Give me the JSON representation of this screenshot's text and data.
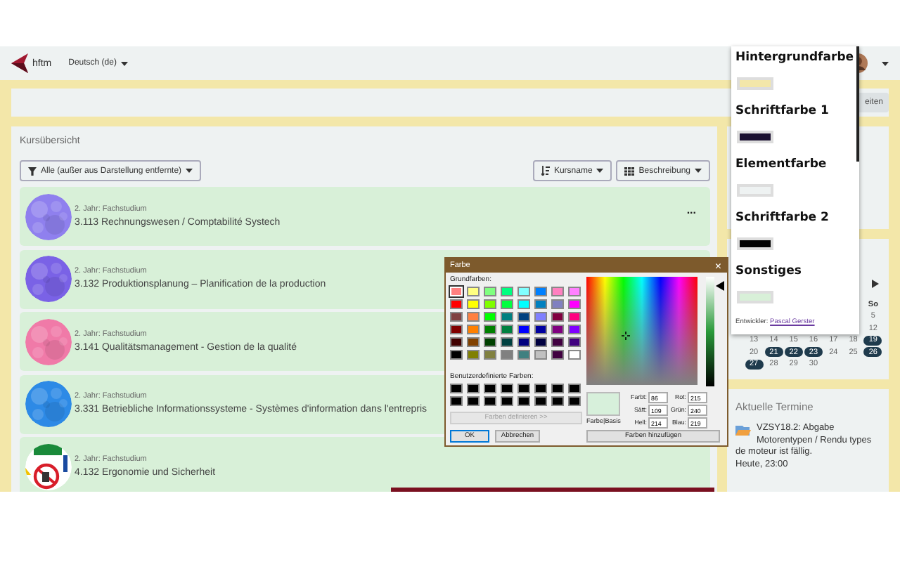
{
  "nav": {
    "logo_text": "hftm",
    "language": "Deutsch (de)"
  },
  "header": {
    "button": "eiten"
  },
  "courses_card": {
    "title": "Kursübersicht",
    "filter": "Alle (außer aus Darstellung entfernte)",
    "sort": "Kursname",
    "view": "Beschreibung",
    "courses": [
      {
        "category": "2. Jahr: Fachstudium",
        "name": "3.113 Rechnungswesen / Comptabilité Systech",
        "menu": "..."
      },
      {
        "category": "2. Jahr: Fachstudium",
        "name": "3.132 Produktionsplanung – Planification de la production"
      },
      {
        "category": "2. Jahr: Fachstudium",
        "name": "3.141 Qualitätsmanagement - Gestion de la qualité"
      },
      {
        "category": "2. Jahr: Fachstudium",
        "name": "3.331 Betriebliche Informationssysteme - Systèmes d'information dans l'entrepris"
      },
      {
        "category": "2. Jahr: Fachstudium",
        "name": "4.132 Ergonomie und Sicherheit"
      }
    ]
  },
  "calendar": {
    "sunday_label": "So",
    "sunday_days": [
      "5",
      "12"
    ],
    "weeks": [
      {
        "days": [
          {
            "day": "13",
            "highlighted": false
          },
          {
            "day": "14",
            "highlighted": false
          },
          {
            "day": "15",
            "highlighted": false
          },
          {
            "day": "16",
            "highlighted": false
          },
          {
            "day": "17",
            "highlighted": false
          },
          {
            "day": "18",
            "highlighted": false
          },
          {
            "day": "19",
            "highlighted": true
          }
        ]
      },
      {
        "days": [
          {
            "day": "20",
            "highlighted": false
          },
          {
            "day": "21",
            "highlighted": true
          },
          {
            "day": "22",
            "highlighted": true
          },
          {
            "day": "23",
            "highlighted": true
          },
          {
            "day": "24",
            "highlighted": false
          },
          {
            "day": "25",
            "highlighted": false
          },
          {
            "day": "26",
            "highlighted": true
          }
        ]
      },
      {
        "days": [
          {
            "day": "27",
            "highlighted": true
          },
          {
            "day": "28",
            "highlighted": false
          },
          {
            "day": "29",
            "highlighted": false
          },
          {
            "day": "30",
            "highlighted": false
          }
        ]
      }
    ]
  },
  "events": {
    "title": "Aktuelle Termine",
    "items": [
      {
        "text": "VZSY18.2: Abgabe Motorentypen / Rendu types de moteur ist fällig.",
        "time": "Heute, 23:00"
      }
    ]
  },
  "theme_popup": {
    "sections": [
      {
        "title": "Hintergrundfarbe",
        "color": "#f3e7a9"
      },
      {
        "title": "Schriftfarbe 1",
        "color": "#1a1030"
      },
      {
        "title": "Elementfarbe",
        "color": "#eef2f2"
      },
      {
        "title": "Schriftfarbe 2",
        "color": "#000000"
      },
      {
        "title": "Sonstiges",
        "color": "#d8f0d8"
      }
    ],
    "credit_label": "Entwickler:",
    "credit_link": "Pascal Gerster"
  },
  "color_dialog": {
    "title": "Farbe",
    "close": "×",
    "basic_label": "Grundfarben:",
    "basic_colors": [
      {
        "color": "#ff8080",
        "selected": true
      },
      {
        "color": "#ffff80",
        "selected": false
      },
      {
        "color": "#80ff80",
        "selected": false
      },
      {
        "color": "#00ff80",
        "selected": false
      },
      {
        "color": "#80ffff",
        "selected": false
      },
      {
        "color": "#0080ff",
        "selected": false
      },
      {
        "color": "#ff80c0",
        "selected": false
      },
      {
        "color": "#ff80ff",
        "selected": false
      },
      {
        "color": "#ff0000",
        "selected": false
      },
      {
        "color": "#ffff00",
        "selected": false
      },
      {
        "color": "#80ff00",
        "selected": false
      },
      {
        "color": "#00ff40",
        "selected": false
      },
      {
        "color": "#00ffff",
        "selected": false
      },
      {
        "color": "#0080c0",
        "selected": false
      },
      {
        "color": "#8080c0",
        "selected": false
      },
      {
        "color": "#ff00ff",
        "selected": false
      },
      {
        "color": "#804040",
        "selected": false
      },
      {
        "color": "#ff8040",
        "selected": false
      },
      {
        "color": "#00ff00",
        "selected": false
      },
      {
        "color": "#008080",
        "selected": false
      },
      {
        "color": "#004080",
        "selected": false
      },
      {
        "color": "#8080ff",
        "selected": false
      },
      {
        "color": "#800040",
        "selected": false
      },
      {
        "color": "#ff0080",
        "selected": false
      },
      {
        "color": "#800000",
        "selected": false
      },
      {
        "color": "#ff8000",
        "selected": false
      },
      {
        "color": "#008000",
        "selected": false
      },
      {
        "color": "#008040",
        "selected": false
      },
      {
        "color": "#0000ff",
        "selected": false
      },
      {
        "color": "#0000a0",
        "selected": false
      },
      {
        "color": "#800080",
        "selected": false
      },
      {
        "color": "#8000ff",
        "selected": false
      },
      {
        "color": "#400000",
        "selected": false
      },
      {
        "color": "#804000",
        "selected": false
      },
      {
        "color": "#004000",
        "selected": false
      },
      {
        "color": "#004040",
        "selected": false
      },
      {
        "color": "#000080",
        "selected": false
      },
      {
        "color": "#000040",
        "selected": false
      },
      {
        "color": "#400040",
        "selected": false
      },
      {
        "color": "#400080",
        "selected": false
      },
      {
        "color": "#000000",
        "selected": false
      },
      {
        "color": "#808000",
        "selected": false
      },
      {
        "color": "#808040",
        "selected": false
      },
      {
        "color": "#808080",
        "selected": false
      },
      {
        "color": "#408080",
        "selected": false
      },
      {
        "color": "#c0c0c0",
        "selected": false
      },
      {
        "color": "#400040",
        "selected": false
      },
      {
        "color": "#ffffff",
        "selected": false
      }
    ],
    "custom_label": "Benutzerdefinierte Farben:",
    "custom_colors": [
      {
        "color": "#000000"
      },
      {
        "color": "#000000"
      },
      {
        "color": "#000000"
      },
      {
        "color": "#000000"
      },
      {
        "color": "#000000"
      },
      {
        "color": "#000000"
      },
      {
        "color": "#000000"
      },
      {
        "color": "#000000"
      },
      {
        "color": "#000000"
      },
      {
        "color": "#000000"
      },
      {
        "color": "#000000"
      },
      {
        "color": "#000000"
      },
      {
        "color": "#000000"
      },
      {
        "color": "#000000"
      },
      {
        "color": "#000000"
      },
      {
        "color": "#000000"
      }
    ],
    "define_button": {
      "label": "Farben definieren >>",
      "disabled": true
    },
    "ok": "OK",
    "cancel": "Abbrechen",
    "preview_label": "Farbe|Basis",
    "preview": {
      "color": "#d7f0db"
    },
    "luminance": {
      "level": 0.92
    },
    "fields": [
      {
        "label": "Farbt:",
        "value": "86"
      },
      {
        "label": "Rot:",
        "value": "215"
      },
      {
        "label": "Sätt:",
        "value": "109"
      },
      {
        "label": "Grün:",
        "value": "240"
      },
      {
        "label": "Hell:",
        "value": "214"
      },
      {
        "label": "Blau:",
        "value": "219"
      }
    ],
    "add_button": "Farben hinzufügen"
  }
}
